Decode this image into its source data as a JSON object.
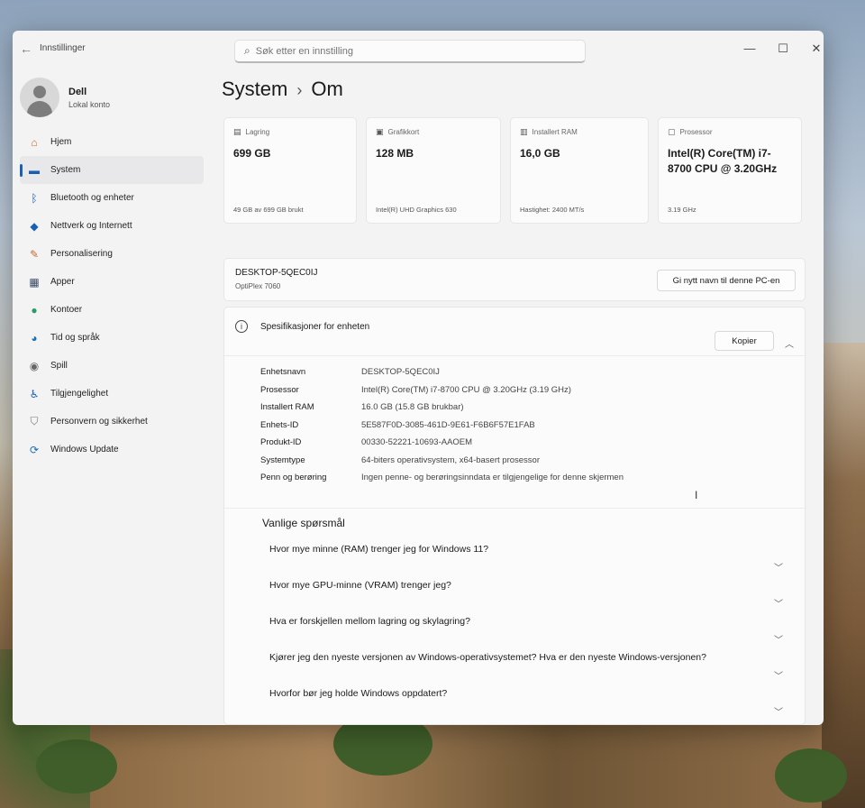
{
  "window": {
    "title": "Innstillinger",
    "search_placeholder": "Søk etter en innstilling",
    "controls": {
      "minimize": "—",
      "maximize": "☐",
      "close": "✕"
    }
  },
  "user": {
    "name": "Dell",
    "account_type": "Lokal konto"
  },
  "sidebar": {
    "items": [
      {
        "label": "Hjem",
        "icon": "home-icon"
      },
      {
        "label": "System",
        "icon": "monitor-icon",
        "active": true
      },
      {
        "label": "Bluetooth og enheter",
        "icon": "bluetooth-icon"
      },
      {
        "label": "Nettverk og Internett",
        "icon": "wifi-icon"
      },
      {
        "label": "Personalisering",
        "icon": "brush-icon"
      },
      {
        "label": "Apper",
        "icon": "apps-icon"
      },
      {
        "label": "Kontoer",
        "icon": "person-icon"
      },
      {
        "label": "Tid og språk",
        "icon": "globe-clock-icon"
      },
      {
        "label": "Spill",
        "icon": "gamepad-icon"
      },
      {
        "label": "Tilgjengelighet",
        "icon": "accessibility-icon"
      },
      {
        "label": "Personvern og sikkerhet",
        "icon": "shield-icon"
      },
      {
        "label": "Windows Update",
        "icon": "update-icon"
      }
    ]
  },
  "breadcrumb": {
    "parent": "System",
    "separator": "›",
    "current": "Om"
  },
  "cards": [
    {
      "heading": "Lagring",
      "icon": "storage-icon",
      "value": "699 GB",
      "sub": "49 GB av 699 GB brukt"
    },
    {
      "heading": "Grafikkort",
      "icon": "gpu-icon",
      "value": "128 MB",
      "sub": "Intel(R) UHD Graphics 630"
    },
    {
      "heading": "Installert RAM",
      "icon": "ram-icon",
      "value": "16,0 GB",
      "sub": "Hastighet: 2400 MT/s"
    },
    {
      "heading": "Prosessor",
      "icon": "cpu-icon",
      "value": "Intel(R) Core(TM) i7-8700 CPU @ 3.20GHz",
      "sub": "3.19 GHz"
    }
  ],
  "pc": {
    "name": "DESKTOP-5QEC0IJ",
    "model": "OptiPlex 7060",
    "rename_label": "Gi nytt navn til denne PC-en"
  },
  "specs": {
    "title": "Spesifikasjoner for enheten",
    "copy_label": "Kopier",
    "rows": [
      {
        "key": "Enhetsnavn",
        "value": "DESKTOP-5QEC0IJ"
      },
      {
        "key": "Prosessor",
        "value": "Intel(R) Core(TM) i7-8700 CPU @ 3.20GHz (3.19 GHz)"
      },
      {
        "key": "Installert RAM",
        "value": "16.0 GB (15.8 GB brukbar)"
      },
      {
        "key": "Enhets-ID",
        "value": "5E587F0D-3085-461D-9E61-F6B6F57E1FAB"
      },
      {
        "key": "Produkt-ID",
        "value": "00330-52221-10693-AAOEM"
      },
      {
        "key": "Systemtype",
        "value": "64-biters operativsystem, x64-basert prosessor"
      },
      {
        "key": "Penn og berøring",
        "value": "Ingen penne- og berøringsinndata er tilgjengelige for denne skjermen"
      }
    ]
  },
  "faq": {
    "title": "Vanlige spørsmål",
    "items": [
      "Hvor mye minne (RAM) trenger jeg for Windows 11?",
      "Hvor mye GPU-minne (VRAM) trenger jeg?",
      "Hva er forskjellen mellom lagring og skylagring?",
      "Kjører jeg den nyeste versjonen av Windows-operativsystemet? Hva er den nyeste Windows-versjonen?",
      "Hvorfor bør jeg holde Windows oppdatert?"
    ]
  }
}
